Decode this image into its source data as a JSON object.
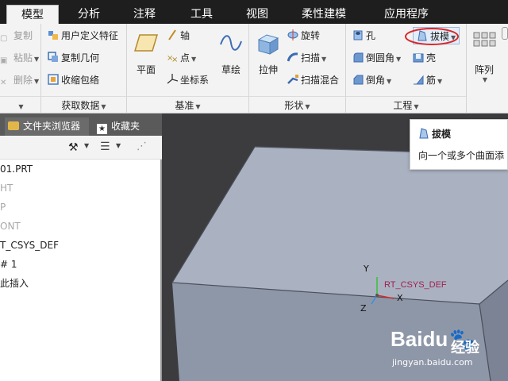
{
  "tabs": [
    "模型",
    "分析",
    "注释",
    "工具",
    "视图",
    "柔性建模",
    "应用程序"
  ],
  "ribbon": {
    "clipboard": {
      "copy": "复制",
      "paste": "粘贴",
      "delete": "删除"
    },
    "get_data": {
      "label": "获取数据",
      "user_feature": "用户定义特征",
      "copy_geometry": "复制几何",
      "shrinkwrap": "收缩包络"
    },
    "datum": {
      "label": "基准",
      "plane": "平面",
      "axis": "轴",
      "point": "点",
      "csys": "坐标系",
      "sketch": "草绘"
    },
    "shapes": {
      "label": "形状",
      "extrude": "拉伸",
      "revolve": "旋转",
      "sweep": "扫描",
      "swept_blend": "扫描混合"
    },
    "engineering": {
      "label": "工程",
      "hole": "孔",
      "draft": "拔模",
      "round": "倒圆角",
      "shell": "壳",
      "chamfer": "倒角",
      "rib": "筋"
    },
    "editing": {
      "pattern": "阵列"
    }
  },
  "tooltip": {
    "title": "拔模",
    "desc": "向一个或多个曲面添"
  },
  "panel": {
    "tabs": [
      "文件夹浏览器",
      "收藏夹"
    ],
    "tree": [
      "01.PRT",
      "HT",
      "P",
      "ONT",
      "T_CSYS_DEF",
      "# 1",
      "此插入"
    ]
  },
  "viewport": {
    "csys_label": "RT_CSYS_DEF",
    "axis_x": "X",
    "axis_y": "Y",
    "axis_z": "Z"
  },
  "watermark": {
    "brand": "Baidu",
    "jingyan": "经验",
    "url": "jingyan.baidu.com"
  },
  "colors": {
    "highlight_ring": "#d8282a",
    "face_top": "#aab2c2",
    "face_front": "#8e97a8"
  }
}
